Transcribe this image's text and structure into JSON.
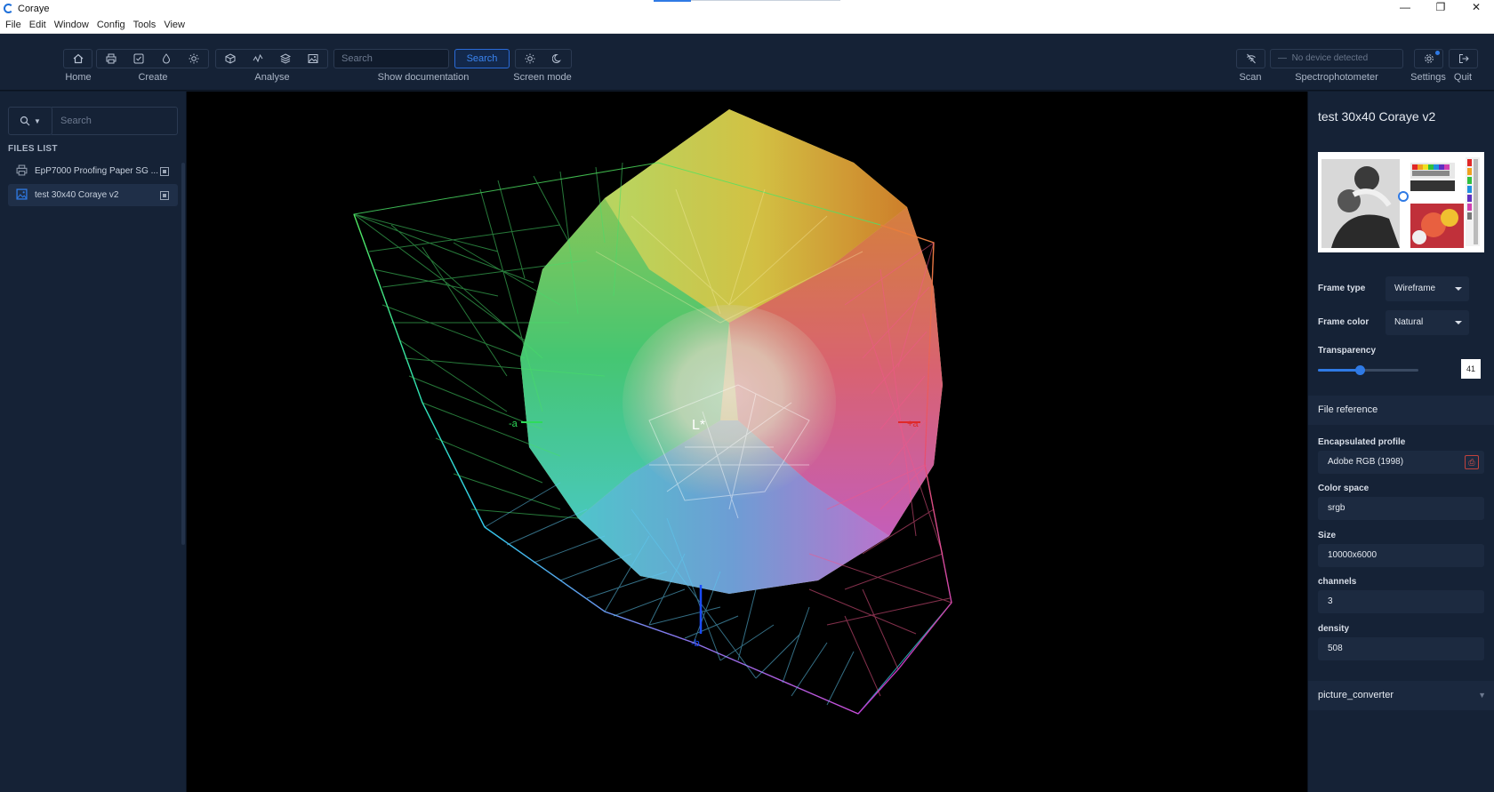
{
  "window": {
    "title": "Coraye",
    "controls": [
      "—",
      "❐",
      "✕"
    ]
  },
  "menu": [
    "File",
    "Edit",
    "Window",
    "Config",
    "Tools",
    "View"
  ],
  "toolbar": {
    "home_label": "Home",
    "create_label": "Create",
    "analyse_label": "Analyse",
    "search_placeholder": "Search",
    "search_button": "Search",
    "show_documentation": "Show documentation",
    "screen_mode_label": "Screen mode",
    "scan_label": "Scan",
    "device_text": "No device detected",
    "spectrophotometer_label": "Spectrophotometer",
    "settings_label": "Settings",
    "quit_label": "Quit"
  },
  "sidebar": {
    "search_placeholder": "Search",
    "files_title": "FILES LIST",
    "files": [
      {
        "name": "EpP7000 Proofing Paper SG ...",
        "icon": "printer-icon",
        "active": false
      },
      {
        "name": "test 30x40 Coraye v2",
        "icon": "image-icon",
        "active": true
      }
    ]
  },
  "viewer": {
    "axis_l": "L*",
    "axis_minus_a": "-a",
    "axis_plus_a": "+a",
    "axis_minus_b": "-b"
  },
  "panel": {
    "title": "test 30x40 Coraye v2",
    "frame_type_label": "Frame type",
    "frame_type_value": "Wireframe",
    "frame_color_label": "Frame color",
    "frame_color_value": "Natural",
    "transparency_label": "Transparency",
    "transparency_value": "41",
    "file_reference_title": "File reference",
    "encapsulated_profile_label": "Encapsulated profile",
    "encapsulated_profile_value": "Adobe RGB (1998)",
    "color_space_label": "Color space",
    "color_space_value": "srgb",
    "size_label": "Size",
    "size_value": "10000x6000",
    "channels_label": "channels",
    "channels_value": "3",
    "density_label": "density",
    "density_value": "508",
    "converter_title": "picture_converter"
  },
  "colors": {
    "accent": "#2f7ae5",
    "background": "#152236",
    "canvas": "#000000"
  }
}
